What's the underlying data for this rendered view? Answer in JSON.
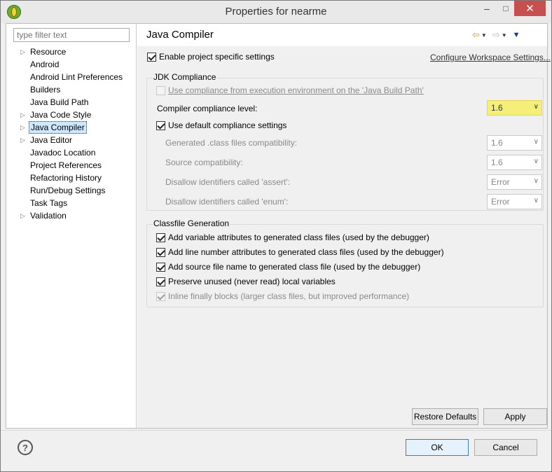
{
  "window": {
    "title": "Properties for nearme",
    "minimize_glyph": "–",
    "maximize_glyph": "□",
    "close_glyph": "✕",
    "accent_close": "#c7504f"
  },
  "sidebar": {
    "filter_placeholder": "type filter text",
    "items": [
      {
        "label": "Resource",
        "expandable": true
      },
      {
        "label": "Android",
        "expandable": false
      },
      {
        "label": "Android Lint Preferences",
        "expandable": false
      },
      {
        "label": "Builders",
        "expandable": false
      },
      {
        "label": "Java Build Path",
        "expandable": false
      },
      {
        "label": "Java Code Style",
        "expandable": true
      },
      {
        "label": "Java Compiler",
        "expandable": true,
        "selected": true
      },
      {
        "label": "Java Editor",
        "expandable": true
      },
      {
        "label": "Javadoc Location",
        "expandable": false
      },
      {
        "label": "Project References",
        "expandable": false
      },
      {
        "label": "Refactoring History",
        "expandable": false
      },
      {
        "label": "Run/Debug Settings",
        "expandable": false
      },
      {
        "label": "Task Tags",
        "expandable": false
      },
      {
        "label": "Validation",
        "expandable": true
      }
    ],
    "arrow_glyph": "▷"
  },
  "page": {
    "title": "Java Compiler",
    "nav": {
      "back_icon": "back-arrow-icon",
      "forward_icon": "forward-arrow-icon",
      "menu_icon": "view-menu-icon"
    },
    "enable_specific": "Enable project specific settings",
    "configure_link": "Configure Workspace Settings...",
    "jdk": {
      "title": "JDK Compliance",
      "use_env_prefix": "Use compliance from execution environment on the ",
      "use_env_link": "'Java Build Path'",
      "compliance_label": "Compiler compliance level:",
      "compliance_value": "1.6",
      "use_default": "Use default compliance settings",
      "generated_label": "Generated .class files compatibility:",
      "generated_value": "1.6",
      "source_label": "Source compatibility:",
      "source_value": "1.6",
      "assert_label": "Disallow identifiers called 'assert':",
      "assert_value": "Error",
      "enum_label": "Disallow identifiers called 'enum':",
      "enum_value": "Error"
    },
    "classfile": {
      "title": "Classfile Generation",
      "opt1": "Add variable attributes to generated class files (used by the debugger)",
      "opt2": "Add line number attributes to generated class files (used by the debugger)",
      "opt3": "Add source file name to generated class file (used by the debugger)",
      "opt4": "Preserve unused (never read) local variables",
      "opt5": "Inline finally blocks (larger class files, but improved performance)"
    },
    "restore_defaults": "Restore Defaults",
    "apply": "Apply"
  },
  "footer": {
    "help_glyph": "?",
    "ok": "OK",
    "cancel": "Cancel"
  }
}
